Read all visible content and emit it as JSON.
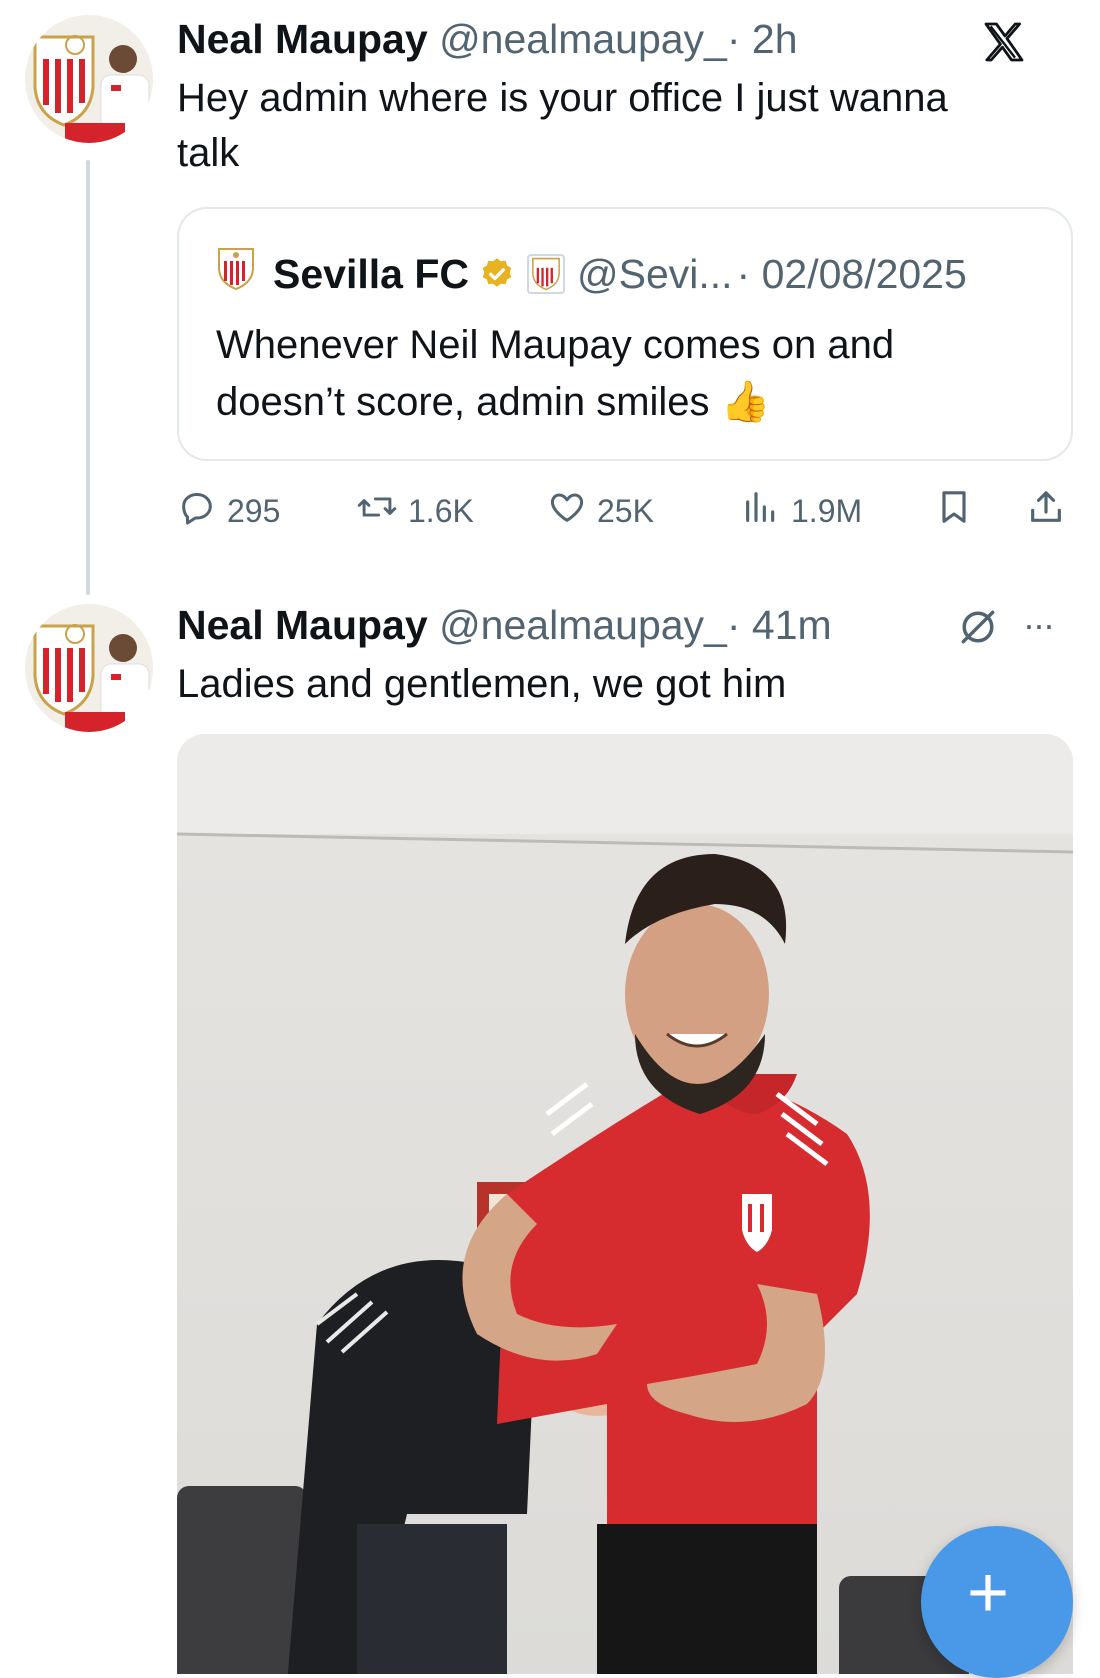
{
  "tweet1": {
    "name": "Neal Maupay",
    "handle": "@nealmaupay_",
    "time": "· 2h",
    "text_line1": "Hey admin where is your office I just wanna",
    "text_line2": "talk"
  },
  "quote": {
    "name": "Sevilla FC",
    "handle": "@Sevi...",
    "date": "· 02/08/2025",
    "text_line1": "Whenever Neil Maupay comes on and",
    "text_line2": "doesn’t score, admin smiles",
    "emoji": "👍"
  },
  "actions": {
    "replies": "295",
    "reposts": "1.6K",
    "likes": "25K",
    "views": "1.9M"
  },
  "tweet2": {
    "name": "Neal Maupay",
    "handle": "@nealmaupay_",
    "time": "· 41m",
    "text": "Ladies and gentlemen, we got him",
    "more": "···"
  },
  "fab": {
    "label": "+"
  },
  "colors": {
    "accent": "#4a99e9",
    "muted": "#536471",
    "sevilla_red": "#d4232b",
    "verified_gold": "#e8b322"
  },
  "icons": [
    "x-logo-icon",
    "reply-icon",
    "repost-icon",
    "like-icon",
    "views-icon",
    "bookmark-icon",
    "share-icon",
    "grok-icon",
    "more-icon",
    "verified-badge-icon",
    "plus-icon"
  ]
}
